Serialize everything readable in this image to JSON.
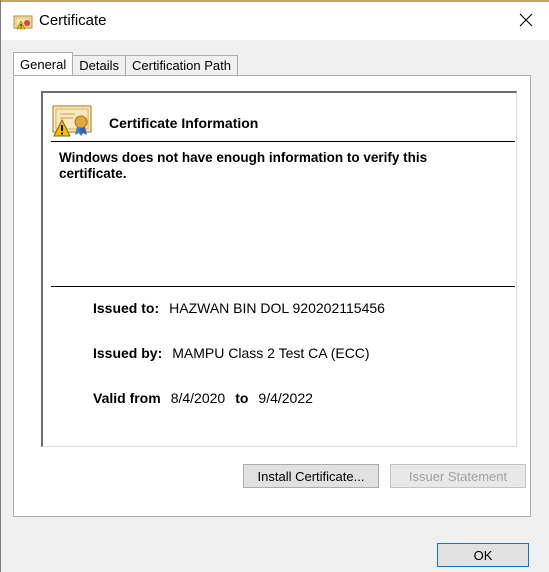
{
  "window": {
    "title": "Certificate",
    "accent": "#0078d7"
  },
  "tabs": [
    {
      "label": "General",
      "active": true
    },
    {
      "label": "Details",
      "active": false
    },
    {
      "label": "Certification Path",
      "active": false
    }
  ],
  "general": {
    "heading": "Certificate Information",
    "warning": "Windows does not have enough information to verify this certificate.",
    "issued_to_label": "Issued to:",
    "issued_to_value": "HAZWAN BIN DOL 920202115456",
    "issued_by_label": "Issued by:",
    "issued_by_value": "MAMPU Class 2 Test CA (ECC)",
    "valid_from_label": "Valid from",
    "valid_from_value": "8/4/2020",
    "valid_to_label": "to",
    "valid_to_value": "9/4/2022"
  },
  "buttons": {
    "install": "Install Certificate...",
    "issuer": "Issuer Statement",
    "ok": "OK"
  },
  "icons": {
    "title": "certificate-warning-icon",
    "close": "close-icon",
    "heading": "certificate-warning-icon"
  }
}
